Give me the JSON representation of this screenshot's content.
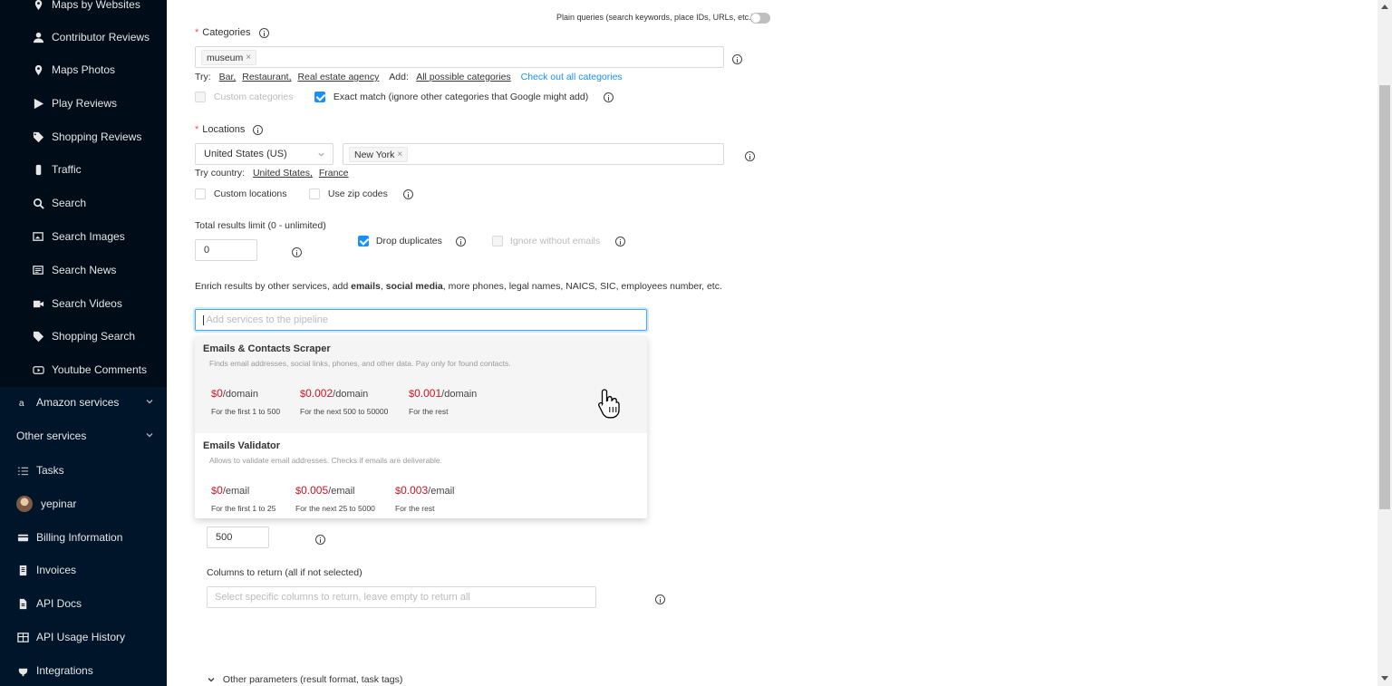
{
  "sidebar": {
    "sub_items": [
      {
        "label": "Maps by Websites",
        "icon": "map-pin-icon"
      },
      {
        "label": "Contributor Reviews",
        "icon": "user-icon"
      },
      {
        "label": "Maps Photos",
        "icon": "map-pin-icon"
      },
      {
        "label": "Play Reviews",
        "icon": "play-icon"
      },
      {
        "label": "Shopping Reviews",
        "icon": "tag-icon"
      },
      {
        "label": "Traffic",
        "icon": "traffic-icon"
      },
      {
        "label": "Search",
        "icon": "search-icon"
      },
      {
        "label": "Search Images",
        "icon": "image-search-icon"
      },
      {
        "label": "Search News",
        "icon": "news-icon"
      },
      {
        "label": "Search Videos",
        "icon": "video-icon"
      },
      {
        "label": "Shopping Search",
        "icon": "tag-icon"
      },
      {
        "label": "Youtube Comments",
        "icon": "youtube-icon"
      }
    ],
    "amazon_services": "Amazon services",
    "other_services": "Other services",
    "tasks": "Tasks",
    "user": "yepinar",
    "billing": "Billing Information",
    "invoices": "Invoices",
    "api_docs": "API Docs",
    "api_usage": "API Usage History",
    "integrations": "Integrations"
  },
  "form": {
    "plain_queries_label": "Plain queries (search keywords, place IDs, URLs, etc.)",
    "categories_label": "Categories",
    "categories_tag": "museum",
    "try_label": "Try:",
    "try_links": [
      "Bar,",
      "Restaurant,",
      "Real estate agency"
    ],
    "add_label": "Add:",
    "add_link": "All possible categories",
    "check_out_link": "Check out all categories",
    "custom_categories": "Custom categories",
    "exact_match": "Exact match (ignore other categories that Google might add)",
    "locations_label": "Locations",
    "country_select": "United States (US)",
    "location_tag": "New York",
    "try_country_label": "Try country:",
    "try_country_links": [
      "United States,",
      "France"
    ],
    "custom_locations": "Custom locations",
    "use_zip_codes": "Use zip codes",
    "total_results_label": "Total results limit (0 - unlimited)",
    "total_results_value": "0",
    "drop_duplicates": "Drop duplicates",
    "ignore_without_emails": "Ignore without emails",
    "enrich_prefix": "Enrich results by other services, add ",
    "enrich_emails": "emails",
    "enrich_comma": ", ",
    "enrich_social": "social media",
    "enrich_suffix": ", more phones, legal names, NAICS, SIC, employees number, etc.",
    "services_placeholder": "Add services to the pipeline",
    "limit_value": "500",
    "columns_label": "Columns to return (all if not selected)",
    "columns_placeholder": "Select specific columns to return, leave empty to return all",
    "other_params": "Other parameters (result format, task tags)"
  },
  "dropdown": {
    "options": [
      {
        "title": "Emails & Contacts Scraper",
        "desc": "Finds email addresses, social links, phones, and other data. Pay only for found contacts.",
        "prices": [
          {
            "cur": "$",
            "amt": "0",
            "unit": "/domain",
            "sub": "For the first 1 to 500"
          },
          {
            "cur": "$",
            "amt": "0.002",
            "unit": "/domain",
            "sub": "For the next 500 to 50000"
          },
          {
            "cur": "$",
            "amt": "0.001",
            "unit": "/domain",
            "sub": "For the rest"
          }
        ]
      },
      {
        "title": "Emails Validator",
        "desc": "Allows to validate email addresses. Checks if emails are deliverable.",
        "prices": [
          {
            "cur": "$",
            "amt": "0",
            "unit": "/email",
            "sub": "For the first 1 to 25"
          },
          {
            "cur": "$",
            "amt": "0.005",
            "unit": "/email",
            "sub": "For the next 25 to 5000"
          },
          {
            "cur": "$",
            "amt": "0.003",
            "unit": "/email",
            "sub": "For the rest"
          }
        ]
      }
    ]
  },
  "colors": {
    "sidebar_bg": "#001529",
    "submenu_bg": "#000c17",
    "accent": "#1890ff",
    "price": "#cf1322",
    "required": "#ff4d4f"
  }
}
